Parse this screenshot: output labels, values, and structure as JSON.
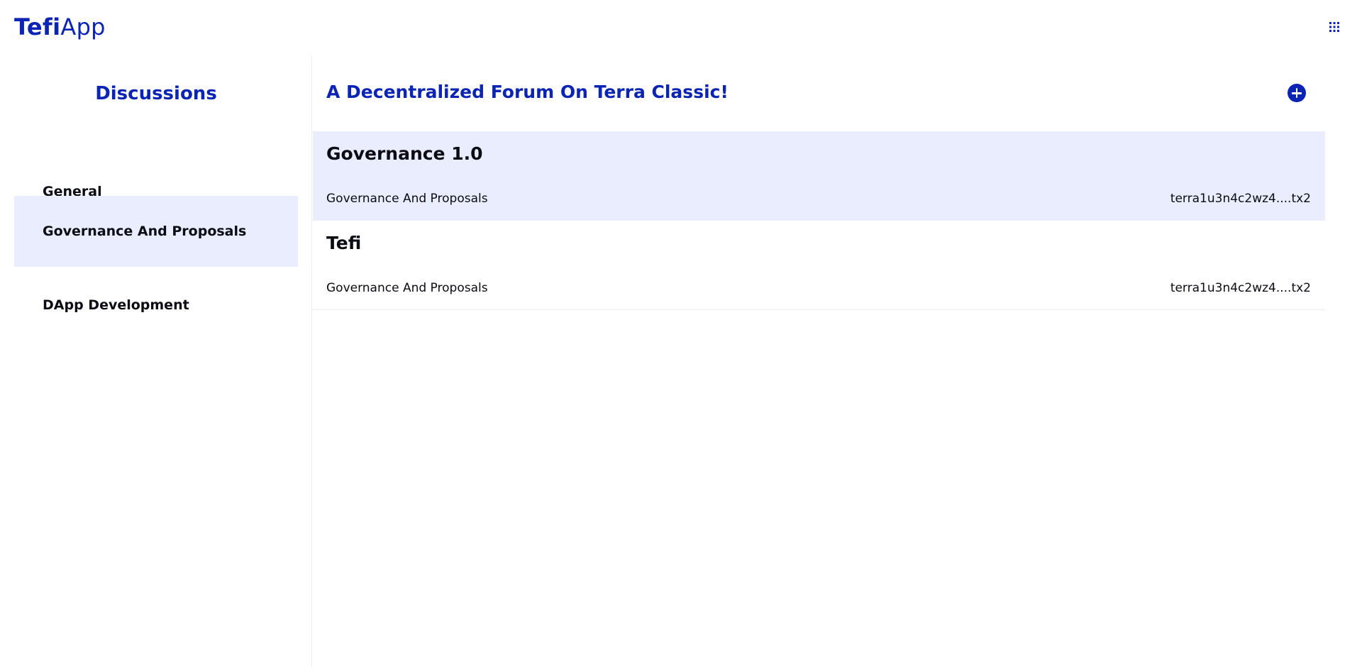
{
  "header": {
    "logo_bold": "Tefi",
    "logo_light": "App",
    "menu_icon": "grid-icon"
  },
  "sidebar": {
    "title": "Discussions",
    "items": [
      {
        "label": "General",
        "active": false
      },
      {
        "label": "Governance And Proposals",
        "active": true
      },
      {
        "label": "DApp Development",
        "active": false
      }
    ]
  },
  "main": {
    "title": "A Decentralized Forum On Terra Classic!",
    "add_icon": "plus-circle-icon",
    "topics": [
      {
        "title": "Governance 1.0",
        "category": "Governance And Proposals",
        "author": "terra1u3n4c2wz4....tx2",
        "active": true
      },
      {
        "title": "Tefi",
        "category": "Governance And Proposals",
        "author": "terra1u3n4c2wz4....tx2",
        "active": false
      }
    ]
  },
  "colors": {
    "brand": "#0b24b3",
    "active_bg": "#e9edfd",
    "text": "#0b0b14"
  }
}
